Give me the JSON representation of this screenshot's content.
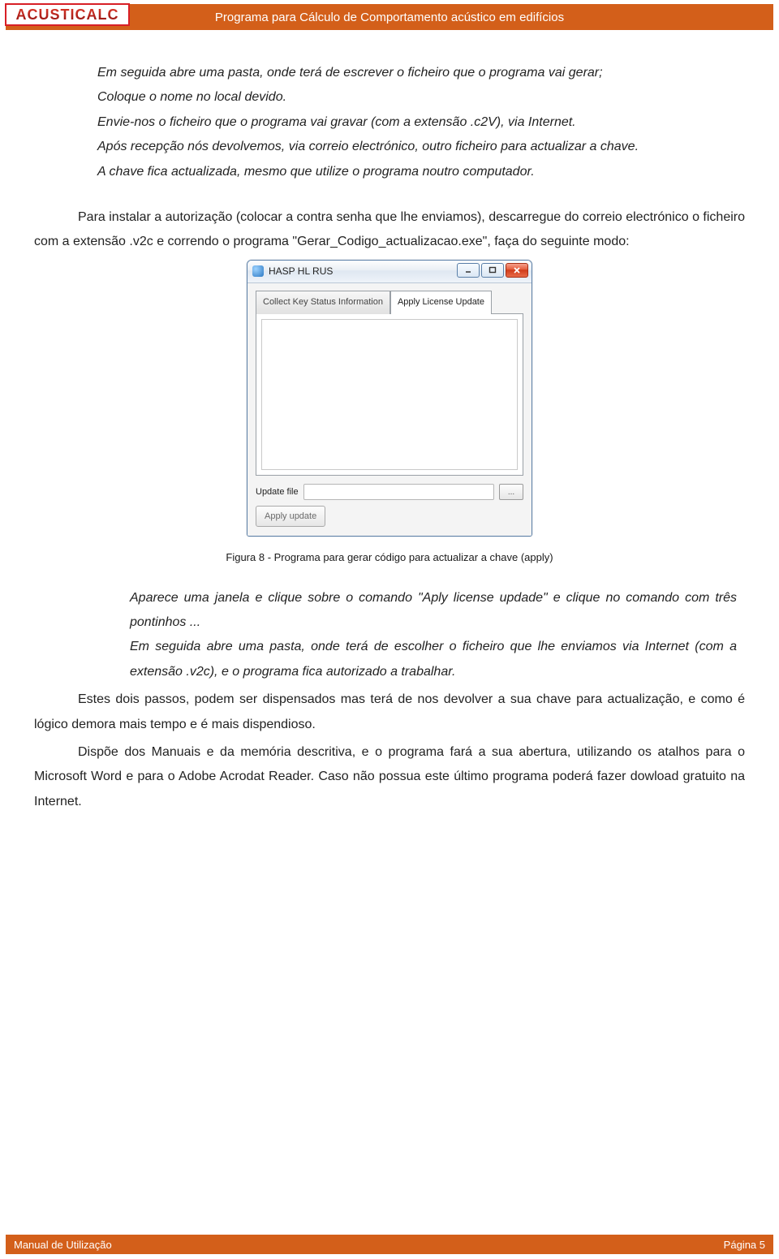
{
  "header": {
    "logo_text": "ACUSTICALC",
    "title": "Programa para Cálculo de Comportamento acústico em edifícios"
  },
  "body": {
    "it1": "Em seguida abre uma pasta, onde terá de escrever o ficheiro que o programa vai gerar;",
    "it2": " Coloque o nome no local devido.",
    "it3": "Envie-nos o ficheiro que o programa vai gravar (com a extensão .c2V),  via Internet.",
    "it4": "Após recepção nós devolvemos, via correio electrónico, outro ficheiro para actualizar a chave.",
    "it5": "A chave fica actualizada, mesmo que utilize o programa noutro computador.",
    "p1": "Para instalar a autorização (colocar a contra senha que lhe enviamos), descarregue do correio electrónico o ficheiro com a extensão .v2c e correndo o programa \"Gerar_Codigo_actualizacao.exe\", faça do seguinte modo:",
    "fig_caption": "Figura 8 - Programa para gerar código para actualizar a chave (apply)",
    "it6": "Aparece uma janela e clique sobre o comando \"Aply license updade\" e clique no comando com três pontinhos ...",
    "it7": "Em seguida abre uma pasta, onde terá de escolher o ficheiro que lhe enviamos via Internet (com a extensão .v2c), e o programa fica autorizado a trabalhar.",
    "p2": "Estes dois passos, podem ser dispensados mas terá de nos devolver a sua chave para actualização, e como é lógico demora mais tempo e é mais dispendioso.",
    "p3": "Dispõe dos Manuais e da memória descritiva, e o programa fará a sua abertura, utilizando os atalhos para o Microsoft Word e para o Adobe Acrodat Reader. Caso não possua este último programa poderá fazer dowload gratuito na Internet."
  },
  "hasp": {
    "title": "HASP HL RUS",
    "tab_collect": "Collect Key Status Information",
    "tab_apply": "Apply License Update",
    "update_file_label": "Update file",
    "browse_label": "...",
    "apply_label": "Apply update"
  },
  "footer": {
    "left": "Manual de Utilização",
    "right": "Página 5"
  }
}
